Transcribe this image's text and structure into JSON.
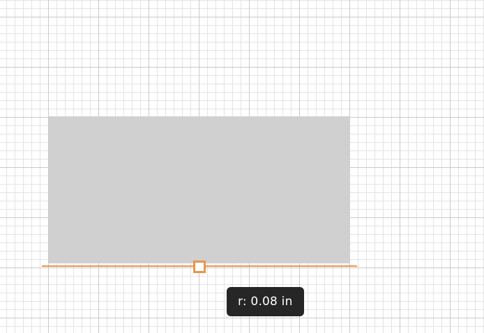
{
  "canvas": {
    "grid": "on",
    "shape_fill": "#d0d0d0",
    "accent_color": "#e8954a"
  },
  "resize_handle": {
    "icon": "square-handle-icon"
  },
  "tooltip": {
    "text": "r: 0.08 in"
  }
}
